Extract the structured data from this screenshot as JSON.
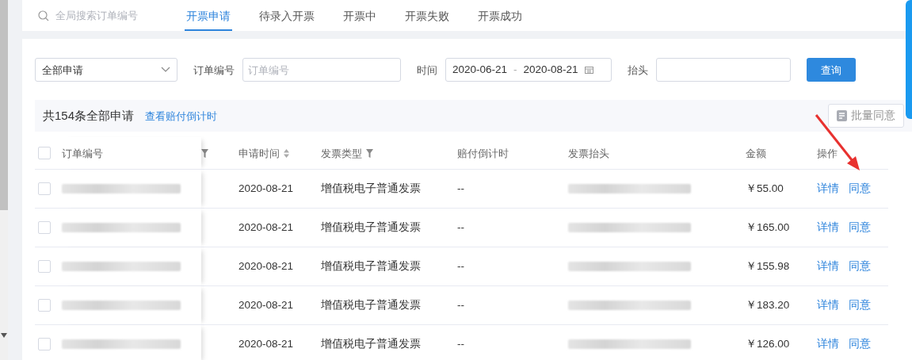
{
  "search": {
    "placeholder": "全局搜索订单编号"
  },
  "tabs": [
    {
      "label": "开票申请",
      "selected": true
    },
    {
      "label": "待录入开票",
      "selected": false
    },
    {
      "label": "开票中",
      "selected": false
    },
    {
      "label": "开票失败",
      "selected": false
    },
    {
      "label": "开票成功",
      "selected": false
    }
  ],
  "filters": {
    "status_select": {
      "value": "全部申请"
    },
    "order_label": "订单编号",
    "order_field": {
      "placeholder": "订单编号"
    },
    "time_label": "时间",
    "date_start": "2020-06-21",
    "date_separator": "-",
    "date_end": "2020-08-21",
    "title_label": "抬头",
    "search_button": "查询"
  },
  "summary": {
    "count_text": "共154条全部申请",
    "link": "查看赔付倒计时",
    "batch_button": "批量同意"
  },
  "table": {
    "select_all": {
      "checked": false
    },
    "columns": [
      "订单编号",
      "申请时间",
      "发票类型",
      "赔付倒计时",
      "发票抬头",
      "金额",
      "操作"
    ],
    "rows": [
      {
        "checked": false,
        "date": "2020-08-21",
        "type": "增值税电子普通发票",
        "countdown": "--",
        "amount": "￥55.00",
        "actions": [
          "详情",
          "同意"
        ]
      },
      {
        "checked": false,
        "date": "2020-08-21",
        "type": "增值税电子普通发票",
        "countdown": "--",
        "amount": "￥165.00",
        "actions": [
          "详情",
          "同意"
        ]
      },
      {
        "checked": false,
        "date": "2020-08-21",
        "type": "增值税电子普通发票",
        "countdown": "--",
        "amount": "￥155.98",
        "actions": [
          "详情",
          "同意"
        ]
      },
      {
        "checked": false,
        "date": "2020-08-21",
        "type": "增值税电子普通发票",
        "countdown": "--",
        "amount": "￥183.20",
        "actions": [
          "详情",
          "同意"
        ]
      },
      {
        "checked": false,
        "date": "2020-08-21",
        "type": "增值税电子普通发票",
        "countdown": "--",
        "amount": "￥126.00",
        "actions": [
          "详情",
          "同意"
        ]
      }
    ]
  }
}
